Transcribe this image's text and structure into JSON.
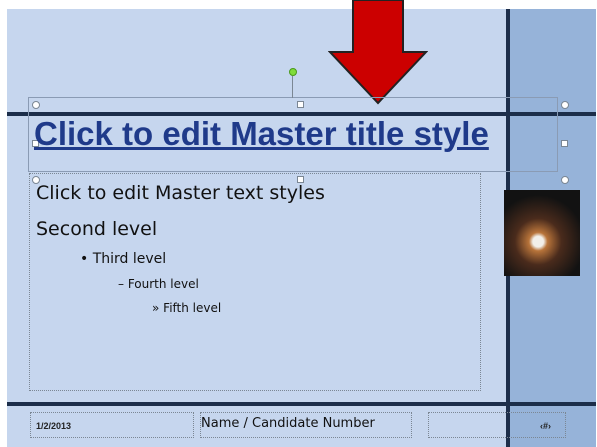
{
  "slide": {
    "title": "Click to edit Master title style",
    "body_levels": [
      "Click to edit Master text styles",
      "Second level",
      "Third level",
      "Fourth level",
      "Fifth level"
    ],
    "bullets": {
      "level3": "•",
      "level4": "–",
      "level5": "»"
    },
    "footer": {
      "date": "1/2/2013",
      "name": "Name / Candidate Number",
      "page_number": "‹#›"
    },
    "image": "lionfish-photo"
  },
  "colors": {
    "slide_bg": "#c6d6ee",
    "side_panel": "#96b3d9",
    "rule_lines": "#1c2e4a",
    "title_text": "#1f3a8a",
    "arrow_fill": "#cc0000"
  }
}
